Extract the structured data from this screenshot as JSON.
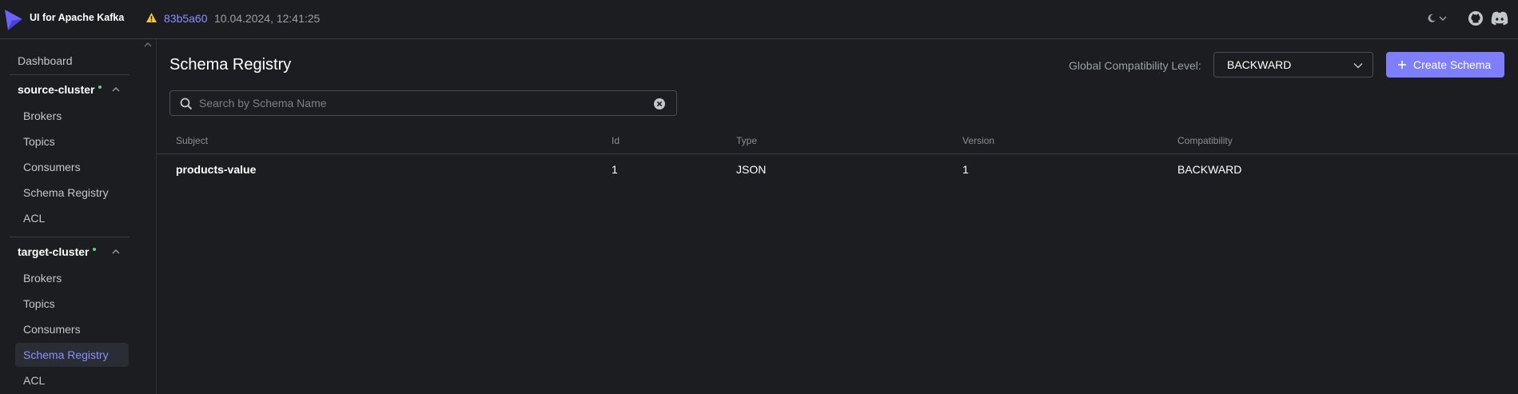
{
  "header": {
    "app_title": "UI for Apache Kafka",
    "version": "83b5a60",
    "build_date": "10.04.2024, 12:41:25"
  },
  "sidebar": {
    "dashboard": "Dashboard",
    "clusters": [
      {
        "name": "source-cluster",
        "items": [
          "Brokers",
          "Topics",
          "Consumers",
          "Schema Registry",
          "ACL"
        ]
      },
      {
        "name": "target-cluster",
        "items": [
          "Brokers",
          "Topics",
          "Consumers",
          "Schema Registry",
          "ACL"
        ],
        "active_item": "Schema Registry"
      }
    ]
  },
  "main": {
    "title": "Schema Registry",
    "compat_label": "Global Compatibility Level:",
    "compat_value": "BACKWARD",
    "create_label": "Create Schema",
    "search_placeholder": "Search by Schema Name",
    "columns": [
      "Subject",
      "Id",
      "Type",
      "Version",
      "Compatibility"
    ],
    "rows": [
      {
        "subject": "products-value",
        "id": "1",
        "type": "JSON",
        "version": "1",
        "compatibility": "BACKWARD"
      }
    ]
  },
  "colors": {
    "accent": "#7e7eff",
    "link": "#8b8fff",
    "status_online": "#5cd685",
    "warning": "#f5c242"
  },
  "icons": [
    "kafka-logo-icon",
    "warning-icon",
    "moon-icon",
    "chevron-down-icon",
    "github-icon",
    "discord-icon",
    "chevron-up-icon",
    "search-icon",
    "clear-icon",
    "plus-icon"
  ]
}
